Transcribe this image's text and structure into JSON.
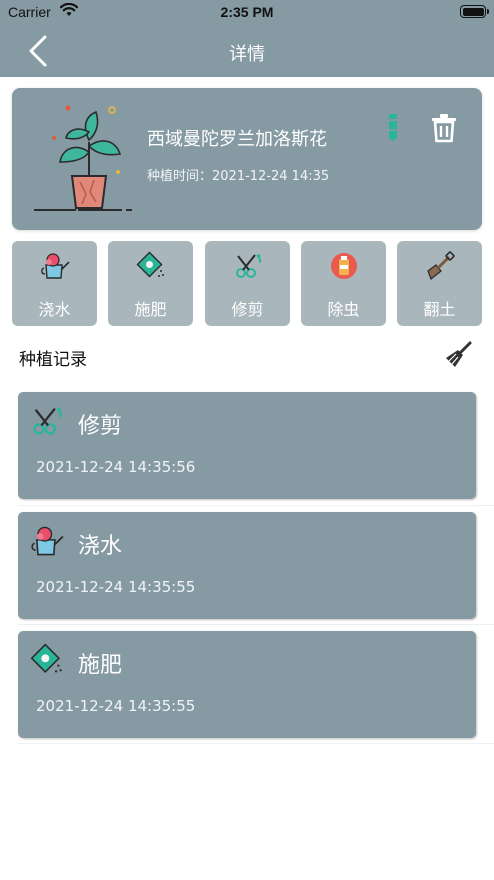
{
  "status_bar": {
    "carrier": "Carrier",
    "time": "2:35 PM"
  },
  "nav": {
    "title": "详情",
    "back_icon": "chevron-left-icon"
  },
  "plant": {
    "name": "西域曼陀罗兰加洛斯花",
    "planting_time": "种植时间：2021-12-24 14:35",
    "edit_icon": "edit-icon",
    "delete_icon": "trash-icon"
  },
  "actions": [
    {
      "label": "浇水",
      "icon": "watering-can-icon"
    },
    {
      "label": "施肥",
      "icon": "fertilizer-bag-icon"
    },
    {
      "label": "修剪",
      "icon": "pruning-shears-icon"
    },
    {
      "label": "除虫",
      "icon": "pesticide-spray-icon"
    },
    {
      "label": "翻土",
      "icon": "shovel-icon"
    }
  ],
  "records_section": {
    "title": "种植记录",
    "clear_icon": "broom-icon"
  },
  "records": [
    {
      "title": "修剪",
      "time": "2021-12-24 14:35:56",
      "icon": "pruning-shears-icon"
    },
    {
      "title": "浇水",
      "time": "2021-12-24 14:35:55",
      "icon": "watering-can-icon"
    },
    {
      "title": "施肥",
      "time": "2021-12-24 14:35:55",
      "icon": "fertilizer-bag-icon"
    }
  ],
  "colors": {
    "header": "#869aa4",
    "card": "#869aa4",
    "action_tile": "#a9b6bc",
    "accent": "#2ab598"
  }
}
